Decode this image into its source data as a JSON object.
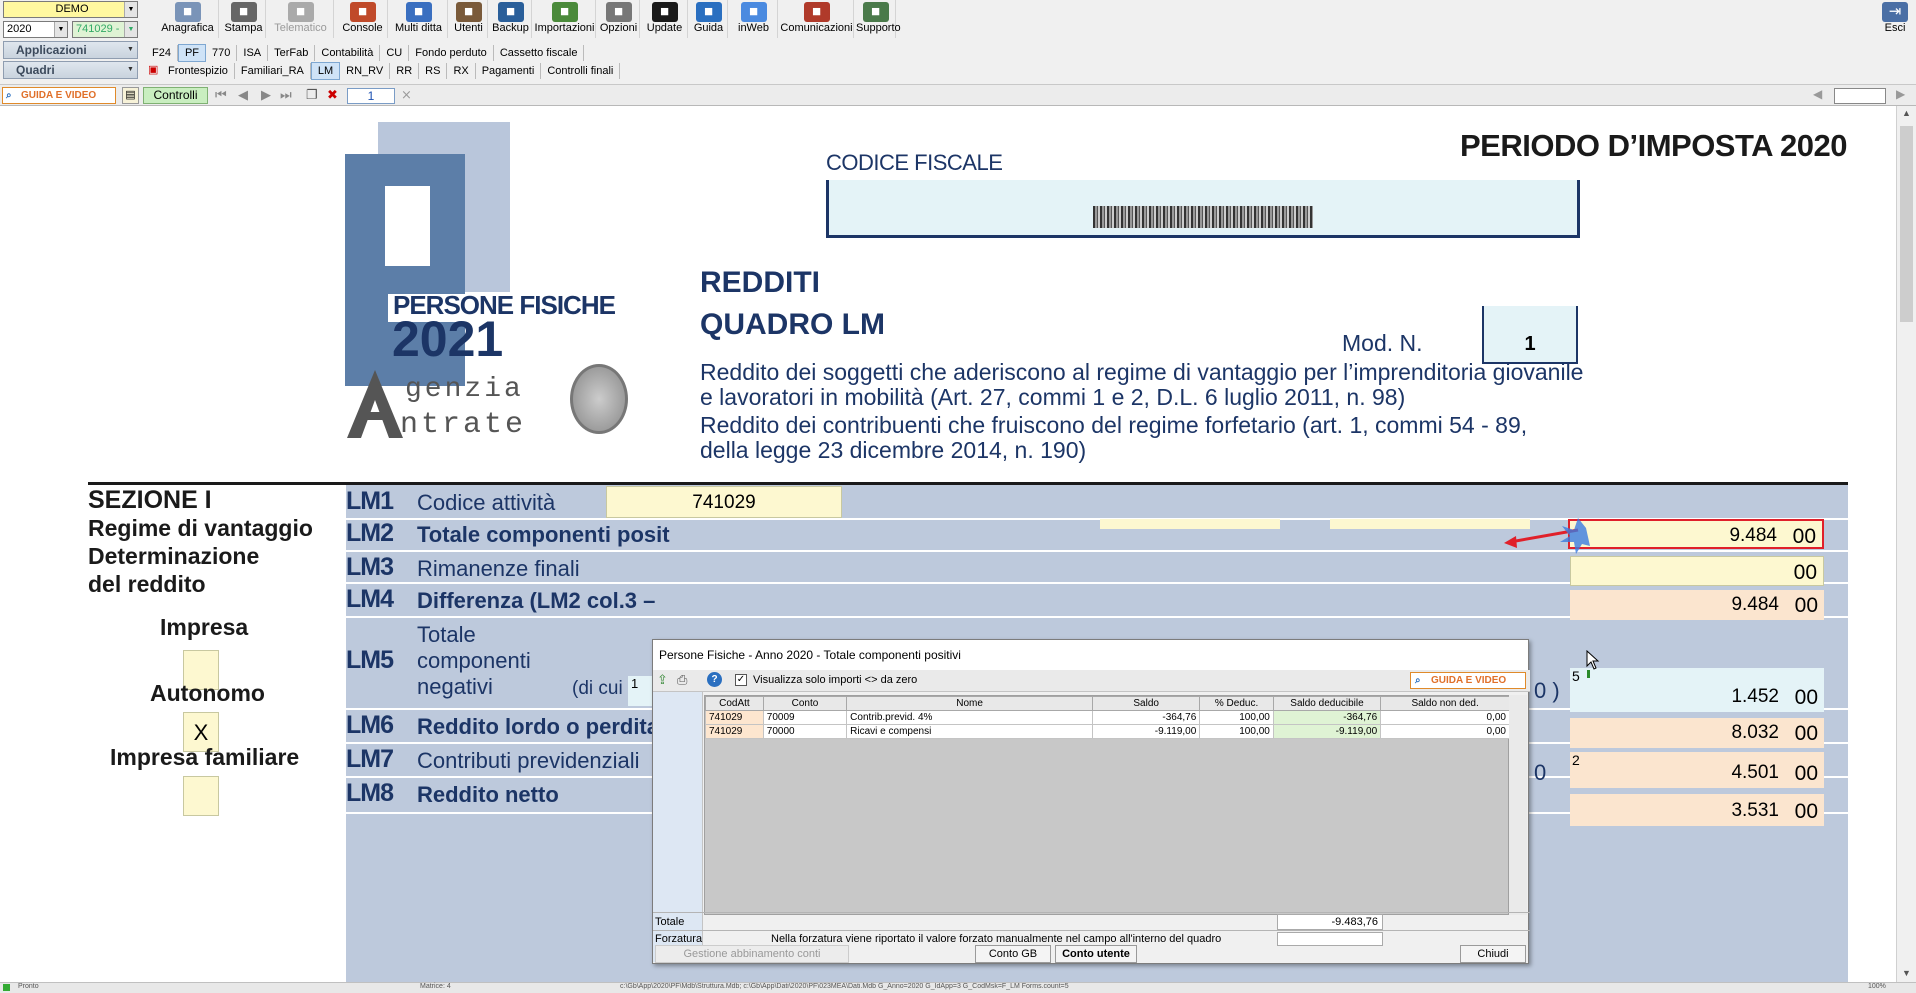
{
  "toolbar": {
    "company": "DEMO",
    "year": "2020",
    "code": "741029 -",
    "applications_label": "Applicazioni",
    "quadri_label": "Quadri",
    "buttons": [
      {
        "label": "Anagrafica",
        "icon": "anagrafica-icon"
      },
      {
        "label": "Stampa",
        "icon": "printer-icon"
      },
      {
        "label": "Telematico",
        "icon": "telematico-icon"
      },
      {
        "label": "Console",
        "icon": "console-icon"
      },
      {
        "label": "Multi ditta",
        "icon": "multi-ditta-icon"
      },
      {
        "label": "Utenti",
        "icon": "users-icon"
      },
      {
        "label": "Backup",
        "icon": "backup-icon"
      },
      {
        "label": "Importazioni",
        "icon": "import-icon"
      },
      {
        "label": "Opzioni",
        "icon": "options-icon"
      },
      {
        "label": "Update",
        "icon": "update-icon"
      },
      {
        "label": "Guida",
        "icon": "help-icon"
      },
      {
        "label": "inWeb",
        "icon": "cloud-icon"
      },
      {
        "label": "Comunicazioni",
        "icon": "communications-icon"
      },
      {
        "label": "Supporto",
        "icon": "support-icon"
      }
    ],
    "exit_label": "Esci"
  },
  "app_tabs": [
    "F24",
    "PF",
    "770",
    "ISA",
    "TerFab",
    "Contabilità",
    "CU",
    "Fondo perduto",
    "Cassetto fiscale"
  ],
  "quadri_tabs": [
    "Frontespizio",
    "Familiari_RA",
    "LM",
    "RN_RV",
    "RR",
    "RS",
    "RX",
    "Pagamenti",
    "Controlli finali"
  ],
  "bar3": {
    "guida_label": "GUIDA E VIDEO",
    "controlli_label": "Controlli",
    "page_number": "1"
  },
  "form": {
    "periodo": "PERIODO D’IMPOSTA 2020",
    "codice_fiscale_label": "CODICE FISCALE",
    "logo_line1": "PERSONE FISICHE",
    "logo_line2": "2021",
    "agenzia_line1": "genzia",
    "agenzia_line2": "ntrate",
    "redditi": "REDDITI",
    "quadro": "QUADRO LM",
    "mod_label": "Mod. N.",
    "mod_value": "1",
    "desc1": "Reddito dei soggetti che aderiscono al regime di vantaggio per l’imprenditoria giovanile",
    "desc2": "e lavoratori in mobilità (Art. 27, commi 1 e 2, D.L. 6 luglio 2011, n. 98)",
    "desc3": "Reddito dei contribuenti che fruiscono del regime forfetario (art. 1, commi 54 - 89,",
    "desc4": "della legge 23 dicembre 2014, n. 190)",
    "sezione_title": "SEZIONE I",
    "sezione_sub1": "Regime di vantaggio",
    "sezione_sub2": "Determinazione",
    "sezione_sub3": "del reddito",
    "impresa_label": "Impresa",
    "autonomo_label": "Autonomo",
    "autonomo_value": "X",
    "impresa_fam_label": "Impresa familiare",
    "rows": [
      {
        "code": "LM1",
        "desc": "Codice attività",
        "value": "741029"
      },
      {
        "code": "LM2",
        "desc": "Totale componenti posit",
        "value": "9.484",
        "dec": "00"
      },
      {
        "code": "LM3",
        "desc": "Rimanenze finali",
        "value": "",
        "dec": "00"
      },
      {
        "code": "LM4",
        "desc": "Differenza (LM2 col.3 –",
        "value": "9.484",
        "dec": "00"
      },
      {
        "code": "LM5",
        "desc": "Totale",
        "desc2": "componenti",
        "desc3": "negativi",
        "dicui": "(di cui",
        "value": "1.452",
        "dec": "00"
      },
      {
        "code": "LM6",
        "desc": "Reddito lordo o perdita",
        "value": "8.032",
        "dec": "00"
      },
      {
        "code": "LM7",
        "desc": "Contributi previdenziali",
        "value": "4.501",
        "dec": "00"
      },
      {
        "code": "LM8",
        "desc": "Reddito netto",
        "value": "3.531",
        "dec": "00"
      }
    ]
  },
  "dialog": {
    "title": "Persone Fisiche - Anno 2020 - Totale componenti positivi",
    "checkbox_label": "Visualizza solo importi <> da zero",
    "guida_label": "GUIDA E VIDEO",
    "columns": [
      "CodAtt",
      "Conto",
      "Nome",
      "Saldo",
      "% Deduc.",
      "Saldo deducibile",
      "Saldo non ded."
    ],
    "rows": [
      [
        "741029",
        "70009",
        "Contrib.previd. 4%",
        "-364,76",
        "100,00",
        "-364,76",
        "0,00"
      ],
      [
        "741029",
        "70000",
        "Ricavi e compensi",
        "-9.119,00",
        "100,00",
        "-9.119,00",
        "0,00"
      ]
    ],
    "totale_label": "Totale",
    "totale_value": "-9.483,76",
    "forzatura_label": "Forzatura",
    "forzatura_note": "Nella forzatura viene riportato il valore forzato manualmente nel campo all'interno del quadro",
    "gestione_label": "Gestione abbinamento conti",
    "conto_gb_label": "Conto GB",
    "conto_utente_label": "Conto utente",
    "chiudi_label": "Chiudi"
  },
  "statusbar": {
    "left": "Pronto",
    "mid1": "Matrice: 4",
    "mid2": "c:\\Gb\\App\\2020\\PF\\Mdb\\Struttura.Mdb; c:\\Gb\\App\\Dati\\2020\\PF\\023MEA\\Dati.Mdb G_Anno=2020 G_IdApp=3 G_CodMsk=F_LM Forms.count=5",
    "zoom": "100%"
  },
  "colors": {
    "accent_red": "#e0202a",
    "navy": "#1c3566",
    "band": "#bdc9dc"
  }
}
